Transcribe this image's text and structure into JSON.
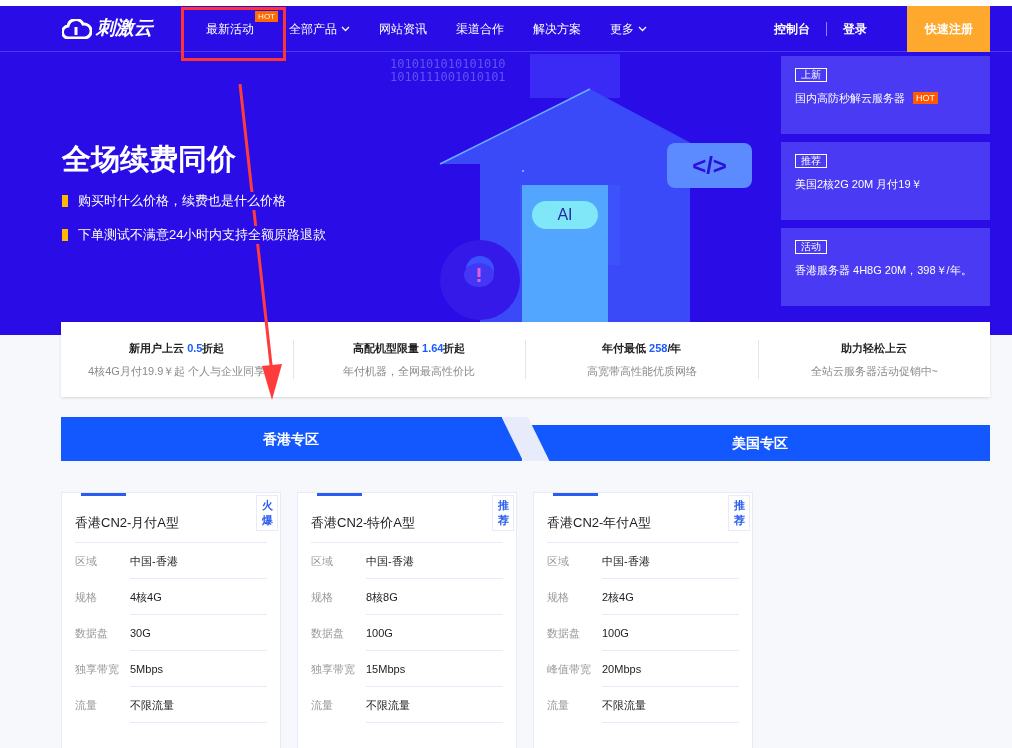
{
  "nav": {
    "logo": "刺激云",
    "items": [
      {
        "label": "最新活动",
        "badge": "HOT",
        "dropdown": false
      },
      {
        "label": "全部产品",
        "dropdown": true
      },
      {
        "label": "网站资讯",
        "dropdown": false
      },
      {
        "label": "渠道合作",
        "dropdown": false
      },
      {
        "label": "解决方案",
        "dropdown": false
      },
      {
        "label": "更多",
        "dropdown": true
      }
    ],
    "console": "控制台",
    "login": "登录",
    "register": "快速注册"
  },
  "hero": {
    "title": "全场续费同价",
    "bullets": [
      "购买时什么价格，续费也是什么价格",
      "下单测试不满意24小时内支持全额原路退款"
    ],
    "binary": [
      "1010101010101010",
      "1010111001010101"
    ],
    "cloud_label": "AI",
    "code_label": "</>",
    "promos": [
      {
        "tag": "上新",
        "text": "国内高防秒解云服务器",
        "badge": "HOT"
      },
      {
        "tag": "推荐",
        "text": "美国2核2G 20M 月付19￥"
      },
      {
        "tag": "活动",
        "text": "香港服务器 4H8G 20M，398￥/年。"
      }
    ]
  },
  "stats": [
    {
      "prefix": "新用户上云 ",
      "highlight": "0.5",
      "suffix": "折起",
      "sub": "4核4G月付19.9￥起 个人与企业同享"
    },
    {
      "prefix": "高配机型限量 ",
      "highlight": "1.64",
      "suffix": "折起",
      "sub": "年付机器，全网最高性价比"
    },
    {
      "prefix": "年付最低 ",
      "highlight": "258",
      "suffix": "/年",
      "sub": "高宽带高性能优质网络"
    },
    {
      "prefix": "助力轻松上云",
      "sub": "全站云服务器活动促销中~"
    }
  ],
  "tabs": [
    {
      "label": "香港专区",
      "selected": true
    },
    {
      "label": "美国专区",
      "selected": false
    }
  ],
  "products": [
    {
      "title": "香港CN2-月付A型",
      "badge": "火爆",
      "specs": [
        {
          "label": "区域",
          "value": "中国-香港"
        },
        {
          "label": "规格",
          "value": "4核4G"
        },
        {
          "label": "数据盘",
          "value": "30G"
        },
        {
          "label": "独享带宽",
          "value": "5Mbps"
        },
        {
          "label": "流量",
          "value": "不限流量"
        }
      ]
    },
    {
      "title": "香港CN2-特价A型",
      "badge": "推荐",
      "specs": [
        {
          "label": "区域",
          "value": "中国-香港"
        },
        {
          "label": "规格",
          "value": "8核8G"
        },
        {
          "label": "数据盘",
          "value": "100G"
        },
        {
          "label": "独享带宽",
          "value": "15Mbps"
        },
        {
          "label": "流量",
          "value": "不限流量"
        }
      ]
    },
    {
      "title": "香港CN2-年付A型",
      "badge": "推荐",
      "specs": [
        {
          "label": "区域",
          "value": "中国-香港"
        },
        {
          "label": "规格",
          "value": "2核4G"
        },
        {
          "label": "数据盘",
          "value": "100G"
        },
        {
          "label": "峰值带宽",
          "value": "20Mbps"
        },
        {
          "label": "流量",
          "value": "不限流量"
        }
      ]
    }
  ]
}
